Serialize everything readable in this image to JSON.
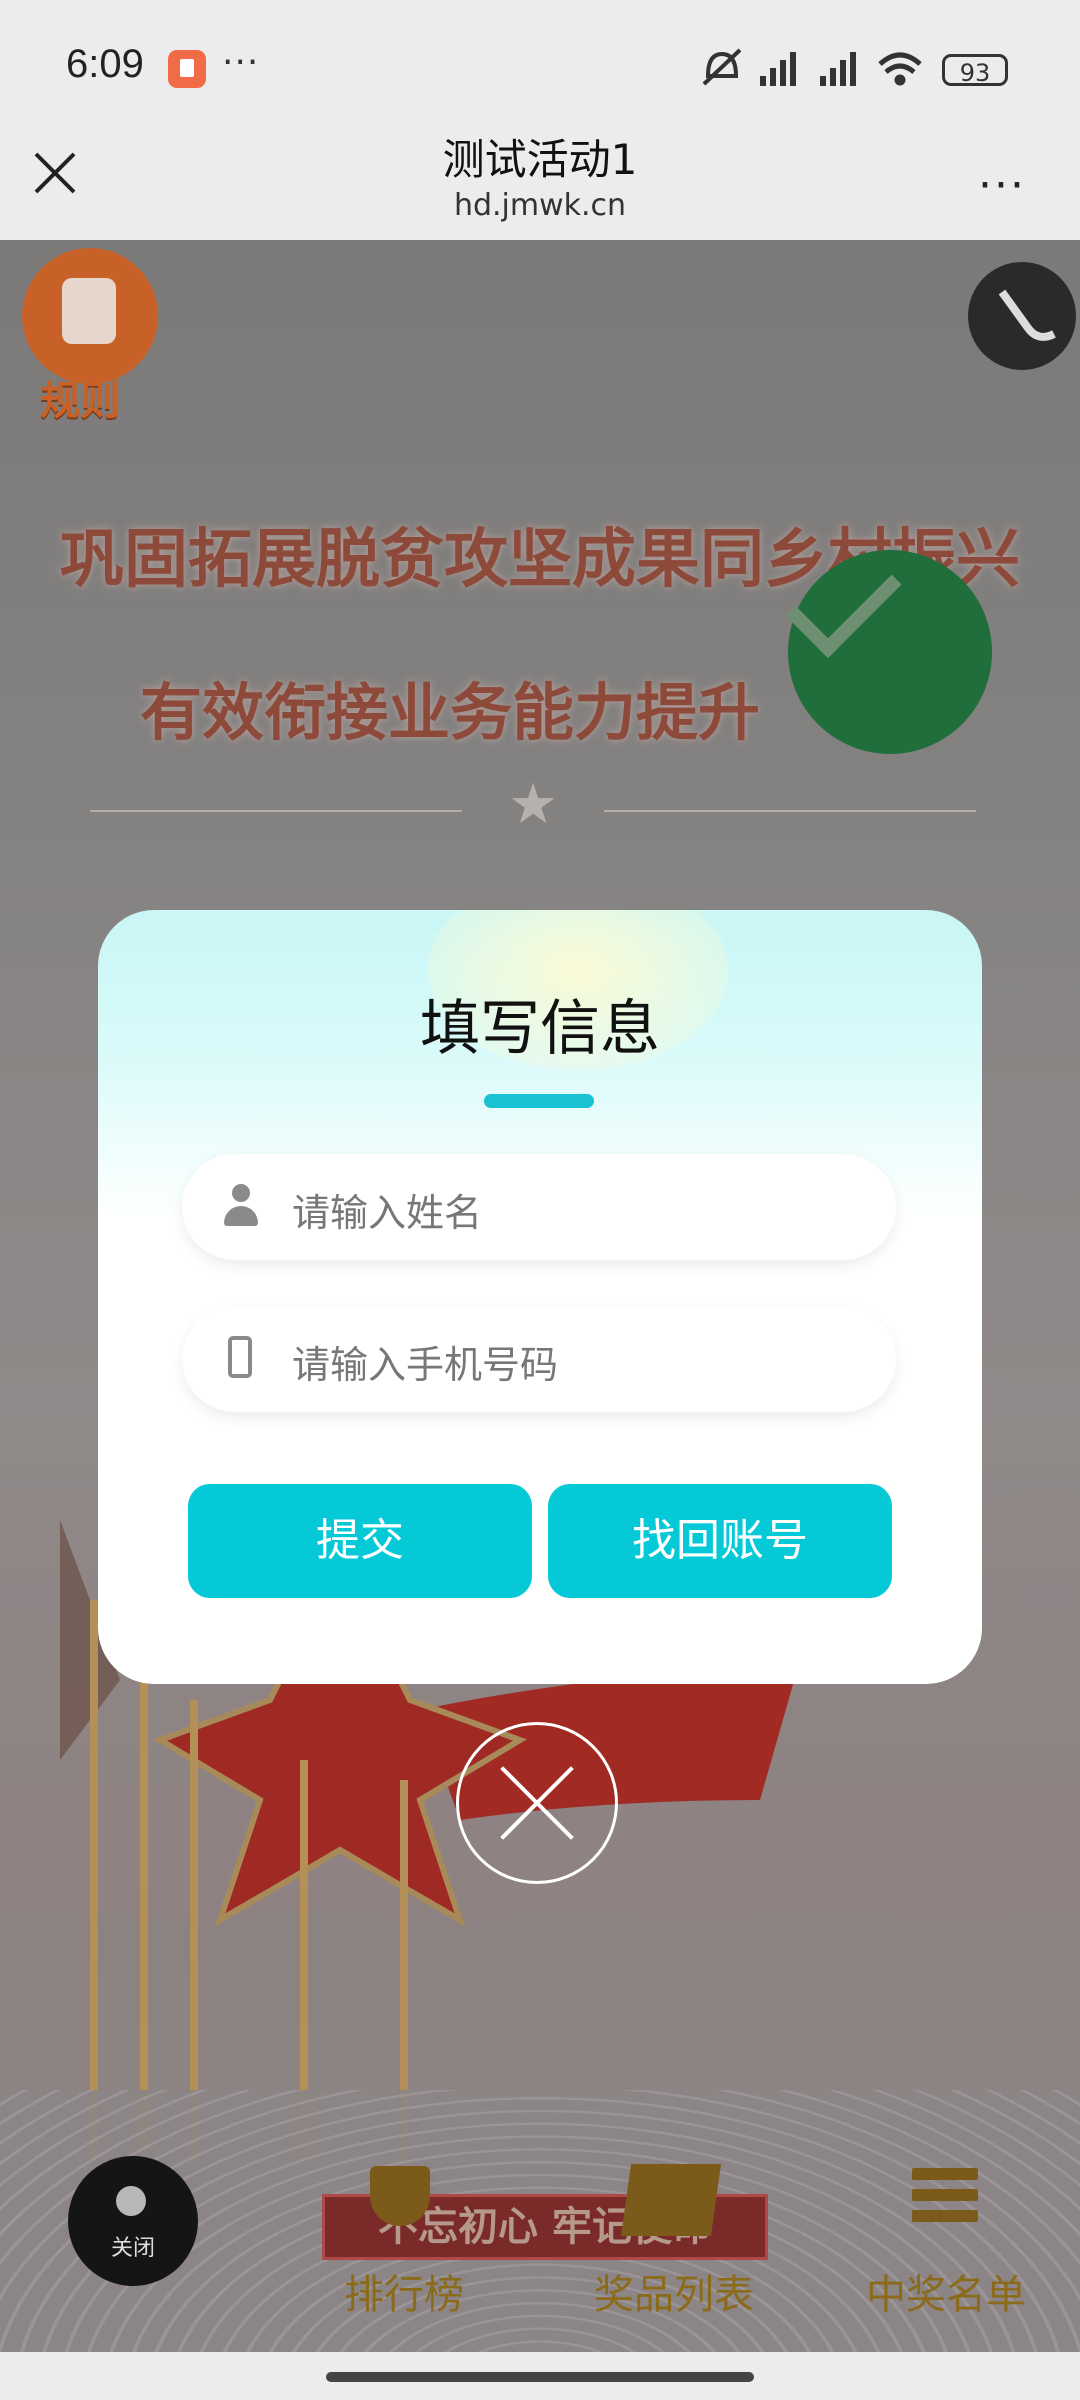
{
  "status_bar": {
    "time": "6:09",
    "more": "···",
    "battery": "93",
    "icons": [
      "app-notification-icon",
      "mute-icon",
      "signal-hd-icon",
      "signal-hd-icon",
      "wifi-icon",
      "battery-icon"
    ]
  },
  "header": {
    "title": "测试活动1",
    "domain": "hd.jmwk.cn",
    "more": "···"
  },
  "background_page": {
    "rules_label": "规则",
    "banner_line1": "巩固拓展脱贫攻坚成果同乡村振兴",
    "banner_line2": "有效衔接业务能力提升",
    "slogan": "不忘初心 牢记使命",
    "close_fab_label": "关闭",
    "nav": [
      {
        "label": "排行榜",
        "icon": "trophy-icon"
      },
      {
        "label": "奖品列表",
        "icon": "gift-boxes-icon"
      },
      {
        "label": "中奖名单",
        "icon": "list-icon"
      }
    ]
  },
  "modal": {
    "title": "填写信息",
    "name_placeholder": "请输入姓名",
    "phone_placeholder": "请输入手机号码",
    "submit_label": "提交",
    "recover_label": "找回账号"
  },
  "colors": {
    "accent": "#06c9d8",
    "nav_text": "#8b6a1a",
    "rules_button": "#c86127",
    "badge_green": "#1f6e3b"
  }
}
